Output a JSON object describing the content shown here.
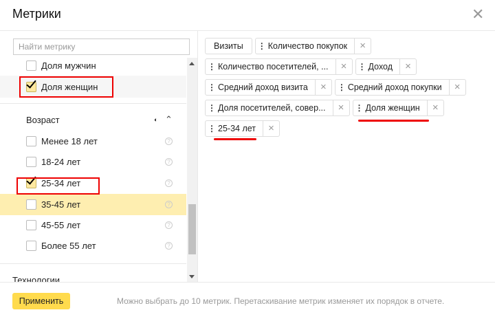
{
  "title": "Метрики",
  "search": {
    "placeholder": "Найти метрику"
  },
  "list": {
    "items_top": [
      {
        "label": "Доля мужчин",
        "checked": false
      },
      {
        "label": "Доля женщин",
        "checked": true
      }
    ],
    "group": "Возраст",
    "age_items": [
      {
        "label": "Менее 18 лет",
        "checked": false
      },
      {
        "label": "18-24 лет",
        "checked": false
      },
      {
        "label": "25-34 лет",
        "checked": true
      },
      {
        "label": "35-45 лет",
        "checked": false
      },
      {
        "label": "45-55 лет",
        "checked": false
      },
      {
        "label": "Более 55 лет",
        "checked": false
      }
    ],
    "next_group": "Технологии"
  },
  "chips": [
    "Визиты",
    "Количество покупок",
    "Количество посетителей, ...",
    "Доход",
    "Средний доход визита",
    "Средний доход покупки",
    "Доля посетителей, совер...",
    "Доля женщин",
    "25-34 лет"
  ],
  "footer": {
    "apply": "Применить",
    "hint": "Можно выбрать до 10 метрик. Перетаскивание метрик изменяет их порядок в отчете."
  },
  "colors": {
    "accent": "#ffdb4d",
    "highlight": "#feeeb0",
    "annotation": "#e00000"
  }
}
